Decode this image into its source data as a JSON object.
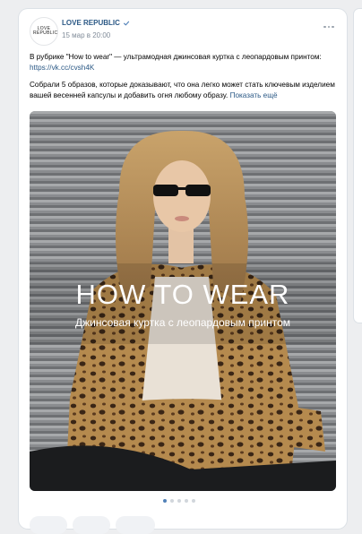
{
  "post": {
    "avatar_text": "LOVE REPUBLIC",
    "author": "LOVE REPUBLIC",
    "time": "15 мар в 20:00",
    "paragraph1_text": "В рубрике \"How to wear\" — ультрамодная джинсовая куртка с леопардовым принтом: ",
    "paragraph1_link": "https://vk.cc/cvsh4K",
    "paragraph2_text": "Собрали 5 образов, которые доказывают, что она легко может стать ключевым изделием вашей весенней капсулы и добавить огня любому образу.",
    "show_more": "Показать ещё"
  },
  "photo": {
    "headline": "HOW TO WEAR",
    "subheadline": "Джинсовая куртка с леопардовым принтом"
  },
  "carousel": {
    "count": 5,
    "active_index": 0
  },
  "colors": {
    "link": "#2a5885",
    "accent": "#5181b8"
  }
}
